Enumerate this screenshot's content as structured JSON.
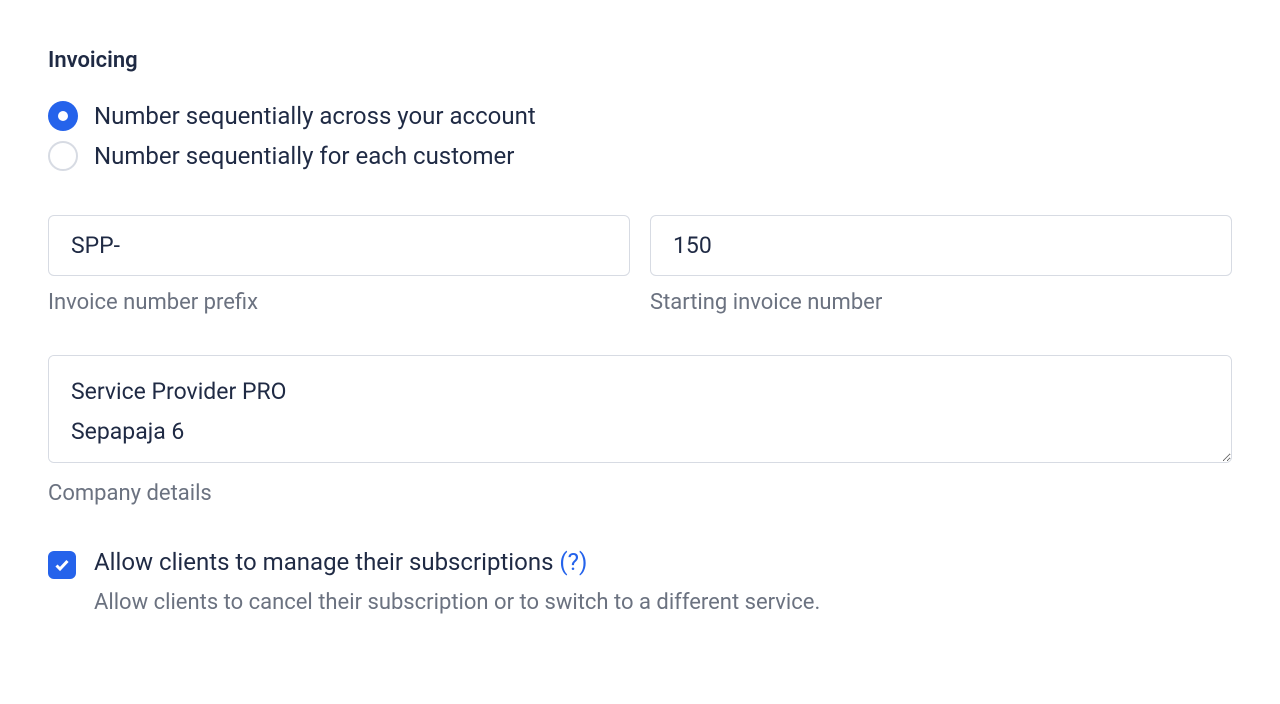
{
  "section": {
    "title": "Invoicing"
  },
  "numbering": {
    "options": [
      {
        "label": "Number sequentially across your account",
        "selected": true
      },
      {
        "label": "Number sequentially for each customer",
        "selected": false
      }
    ]
  },
  "prefix": {
    "value": "SPP-",
    "caption": "Invoice number prefix"
  },
  "starting": {
    "value": "150",
    "caption": "Starting invoice number"
  },
  "company": {
    "value": "Service Provider PRO\nSepapaja 6",
    "caption": "Company details"
  },
  "allow_clients": {
    "label": "Allow clients to manage their subscriptions ",
    "help": "(?)",
    "description": "Allow clients to cancel their subscription or to switch to a different service.",
    "checked": true
  }
}
